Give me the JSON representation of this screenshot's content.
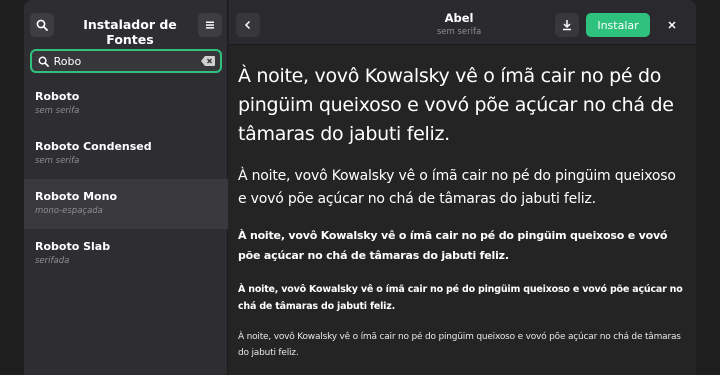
{
  "sidebar": {
    "title": "Instalador de Fontes",
    "search": {
      "value": "Robo",
      "placeholder": ""
    },
    "fonts": [
      {
        "name": "Roboto",
        "style": "sem serifa"
      },
      {
        "name": "Roboto Condensed",
        "style": "sem serifa"
      },
      {
        "name": "Roboto Mono",
        "style": "mono-espaçada"
      },
      {
        "name": "Roboto Slab",
        "style": "serifada"
      }
    ]
  },
  "header": {
    "title": "Abel",
    "subtitle": "sem serifa",
    "install_label": "Instalar"
  },
  "preview": {
    "sample": "À noite, vovô Kowalsky vê o ímã cair no pé do pingüim queixoso e vovó põe açúcar no chá de tâmaras do jabuti feliz."
  },
  "colors": {
    "accent": "#2ec27e",
    "sidebar_bg": "#2e2e32",
    "main_bg": "#242424",
    "selected_row": "#3a3a3e"
  },
  "icons": [
    "search-icon",
    "menu-icon",
    "clear-icon",
    "back-icon",
    "download-icon",
    "close-icon"
  ]
}
